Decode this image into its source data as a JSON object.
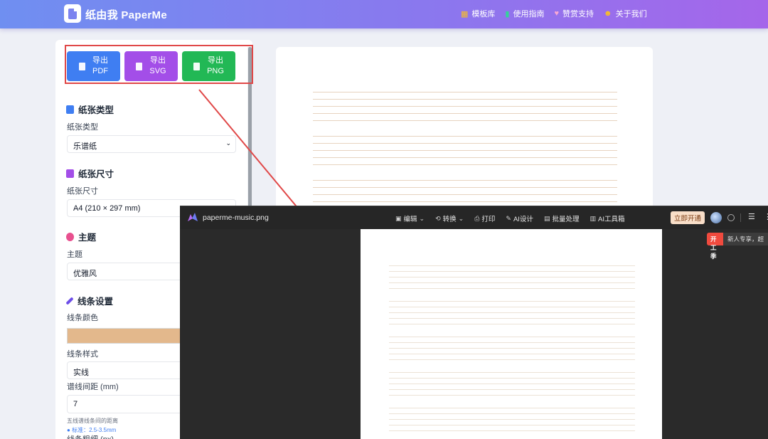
{
  "header": {
    "brand": "纸由我 PaperMe",
    "nav": [
      {
        "icon": "grid-icon",
        "label": "模板库",
        "color": "#fbbf24"
      },
      {
        "icon": "book-icon",
        "label": "使用指南",
        "color": "#34d399"
      },
      {
        "icon": "heart-icon",
        "label": "赞赏支持",
        "color": "#f9a8d4"
      },
      {
        "icon": "users-icon",
        "label": "关于我们",
        "color": "#fbbf24"
      }
    ]
  },
  "export": {
    "pdf": {
      "line1": "导出",
      "line2": "PDF"
    },
    "svg": {
      "line1": "导出",
      "line2": "SVG"
    },
    "png": {
      "line1": "导出",
      "line2": "PNG"
    }
  },
  "sections": {
    "paper_type": {
      "title": "纸张类型",
      "label": "纸张类型",
      "value": "乐谱纸"
    },
    "paper_size": {
      "title": "纸张尺寸",
      "label": "纸张尺寸",
      "value": "A4 (210 × 297 mm)"
    },
    "theme": {
      "title": "主题",
      "label": "主题",
      "value": "优雅风"
    },
    "lines": {
      "title": "线条设置",
      "color_label": "线条颜色",
      "color_value": "#e3b88c",
      "style_label": "线条样式",
      "style_value": "实线",
      "spacing_label": "谱线间距 (mm)",
      "spacing_value": "7",
      "spacing_hint": "五线谱线条间的距离",
      "spacing_tip": "标准：2.5-3.5mm",
      "width_label": "线条粗细 (px)"
    }
  },
  "viewer": {
    "filename": "paperme-music.png",
    "tools": [
      {
        "icon": "edit-icon",
        "label": "编辑",
        "dropdown": true
      },
      {
        "icon": "convert-icon",
        "label": "转换",
        "dropdown": true
      },
      {
        "icon": "print-icon",
        "label": "打印",
        "dropdown": false
      },
      {
        "icon": "ai-design-icon",
        "label": "AI设计",
        "dropdown": false
      },
      {
        "icon": "batch-icon",
        "label": "批量处理",
        "dropdown": false
      },
      {
        "icon": "toolbox-icon",
        "label": "AI工具箱",
        "dropdown": false
      }
    ],
    "open_button": "立即开通",
    "promo_tag": "开工季",
    "promo_text": "新人专享，超"
  }
}
